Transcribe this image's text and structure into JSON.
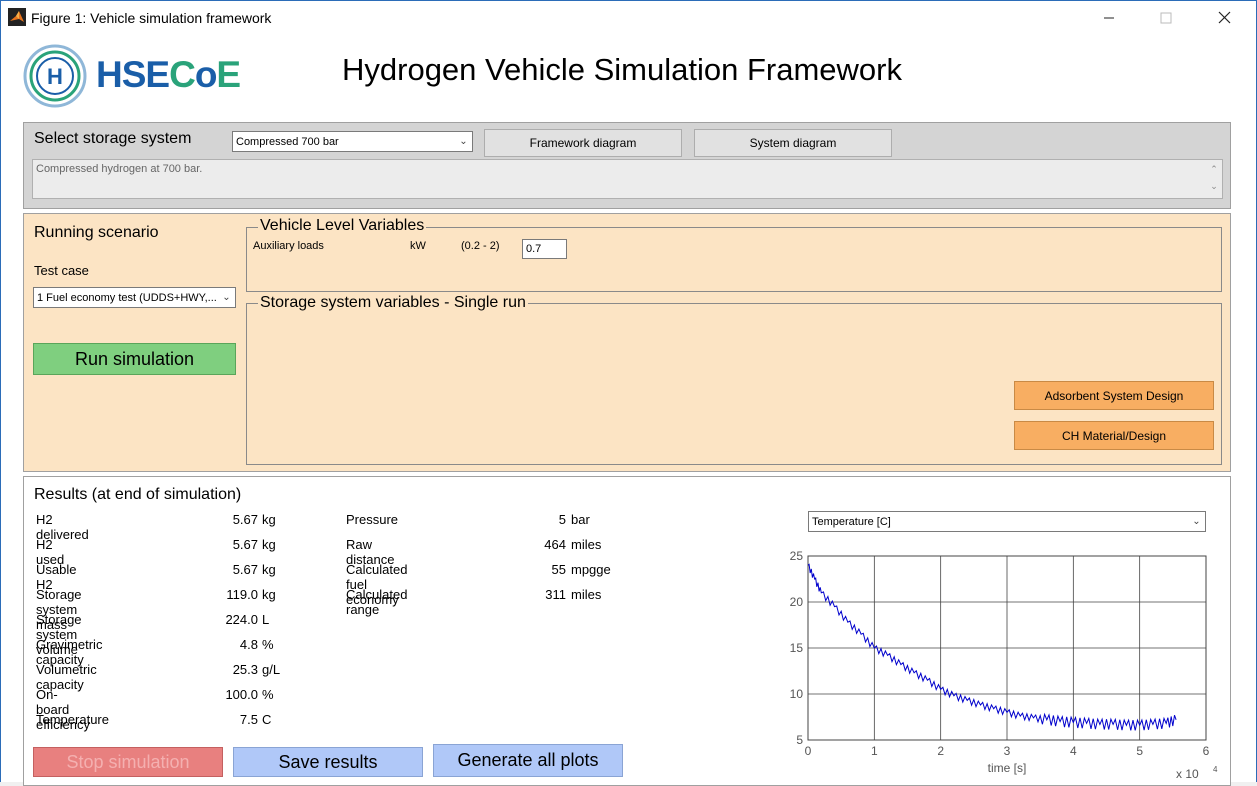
{
  "window": {
    "title": "Figure 1: Vehicle simulation framework"
  },
  "header": {
    "logo_text": "HSECoE",
    "app_title": "Hydrogen Vehicle Simulation Framework"
  },
  "storage": {
    "label": "Select storage system",
    "selected": "Compressed 700 bar",
    "framework_button": "Framework diagram",
    "system_button": "System diagram",
    "description": "Compressed hydrogen at 700 bar."
  },
  "scenario": {
    "label": "Running scenario",
    "test_case_label": "Test case",
    "test_case_selected": "1  Fuel economy test (UDDS+HWY,...",
    "run_button": "Run simulation"
  },
  "vehicle_vars": {
    "title": "Vehicle Level Variables",
    "aux_label": "Auxiliary loads",
    "aux_unit": "kW",
    "aux_range": "(0.2 - 2)",
    "aux_value": "0.7"
  },
  "storage_vars": {
    "title": "Storage system variables - Single run",
    "adsorbent_button": "Adsorbent System Design",
    "ch_button": "CH Material/Design"
  },
  "results": {
    "title": "Results (at end of simulation)",
    "left": [
      {
        "label": "H2 delivered",
        "value": "5.67",
        "unit": "kg"
      },
      {
        "label": "H2 used",
        "value": "5.67",
        "unit": "kg"
      },
      {
        "label": "Usable H2",
        "value": "5.67",
        "unit": "kg"
      },
      {
        "label": "Storage system mass",
        "value": "119.0",
        "unit": "kg"
      },
      {
        "label": "Storage system volume",
        "value": "224.0",
        "unit": "L"
      },
      {
        "label": "Gravimetric capacity",
        "value": "4.8",
        "unit": "%"
      },
      {
        "label": "Volumetric capacity",
        "value": "25.3",
        "unit": "g/L"
      },
      {
        "label": "On-board efficiency",
        "value": "100.0",
        "unit": "%"
      },
      {
        "label": "Temperature",
        "value": "7.5",
        "unit": "C"
      }
    ],
    "right": [
      {
        "label": "Pressure",
        "value": "5",
        "unit": "bar"
      },
      {
        "label": "Raw distance",
        "value": "464",
        "unit": "miles"
      },
      {
        "label": "Calculated fuel economy",
        "value": "55",
        "unit": "mpgge"
      },
      {
        "label": "Calculated range",
        "value": "311",
        "unit": "miles"
      }
    ],
    "stop_button": "Stop simulation",
    "save_button": "Save results",
    "generate_button": "Generate all plots",
    "plot_select": "Temperature [C]"
  },
  "chart_data": {
    "type": "line",
    "xlabel": "time [s]",
    "ylabel": "",
    "x_multiplier": "x 10",
    "x_multiplier_exp": "4",
    "xlim": [
      0,
      6
    ],
    "ylim": [
      5,
      25
    ],
    "xticks": [
      "0",
      "1",
      "2",
      "3",
      "4",
      "5",
      "6"
    ],
    "yticks": [
      "5",
      "10",
      "15",
      "20",
      "25"
    ],
    "grid": true,
    "series_color": "#0000cc",
    "x": [
      0,
      0.1,
      0.2,
      0.4,
      0.6,
      0.8,
      1.0,
      1.2,
      1.4,
      1.6,
      1.8,
      2.0,
      2.2,
      2.4,
      2.6,
      2.8,
      3.0,
      3.2,
      3.4,
      3.6,
      3.8,
      4.0,
      4.2,
      4.4,
      4.6,
      4.8,
      5.0,
      5.2,
      5.4,
      5.55
    ],
    "y": [
      24,
      22.5,
      21,
      19.5,
      17.8,
      16.5,
      15,
      14.2,
      13.2,
      12.3,
      11.5,
      10.5,
      9.8,
      9.3,
      8.8,
      8.4,
      8.0,
      7.6,
      7.4,
      7.2,
      7.0,
      6.9,
      6.8,
      6.7,
      6.7,
      6.6,
      6.6,
      6.7,
      6.8,
      7.2
    ]
  }
}
